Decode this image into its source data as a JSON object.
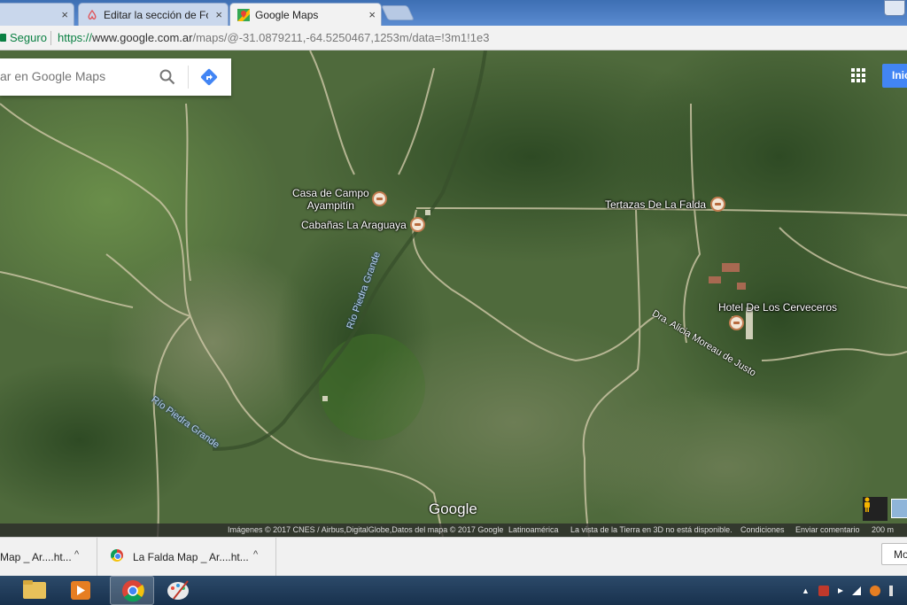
{
  "browser": {
    "tabs": [
      {
        "label": "",
        "close": "×"
      },
      {
        "label": "Editar la sección de Fotos",
        "close": "×"
      },
      {
        "label": "Google Maps",
        "close": "×"
      }
    ],
    "secure_label": "Seguro",
    "url_scheme": "https://",
    "url_host": "www.google.com.ar",
    "url_path": "/maps/@-31.0879211,-64.5250467,1253m/data=!3m1!1e3"
  },
  "maps": {
    "search_placeholder": "ar en Google Maps",
    "signin_label": "Inic",
    "places": [
      {
        "name": "Casa de Campo",
        "name2": "Ayampitín"
      },
      {
        "name": "Cabañas La Araguaya"
      },
      {
        "name": "Tertazas De La Falda"
      },
      {
        "name": "Hotel De Los Cerveceros"
      }
    ],
    "roads": [
      "Dra. Alicia Moreau de Justo"
    ],
    "rivers": [
      "Río Piedra Grande",
      "Río Piedra Grande"
    ],
    "logo": "Google",
    "attribution": {
      "imagery": "Imágenes © 2017 CNES / Airbus,DigitalGlobe,Datos del mapa © 2017 Google",
      "region": "Latinoamérica",
      "earth3d": "La vista de la Tierra en 3D no está disponible.",
      "terms": "Condiciones",
      "feedback": "Enviar comentario",
      "scale": "200 m"
    }
  },
  "downloads": {
    "items": [
      {
        "name": "Map _ Ar....ht...",
        "chevron": "^"
      },
      {
        "name": "La Falda Map _ Ar....ht...",
        "chevron": "^"
      }
    ],
    "show_all_label": "Mo"
  },
  "colors": {
    "accent": "#4285f4",
    "secure": "#0b8043",
    "terrain": "#4f6a3c"
  }
}
